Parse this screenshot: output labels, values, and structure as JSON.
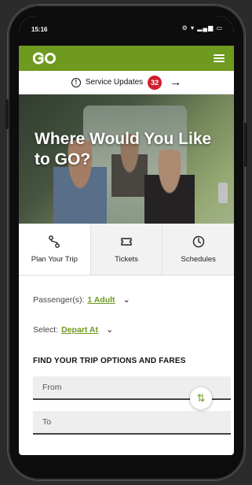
{
  "status_bar": {
    "time": "15:16",
    "icons": "⚙ ▾ ▂▄▆ ▭"
  },
  "header": {
    "menu_icon": "hamburger-menu-icon"
  },
  "service_updates": {
    "label": "Service Updates",
    "count": "32",
    "arrow": "→",
    "info_glyph": "!"
  },
  "hero": {
    "title": "Where Would You Like to GO?"
  },
  "tabs": [
    {
      "label": "Plan Your Trip",
      "icon": "route-icon",
      "active": true
    },
    {
      "label": "Tickets",
      "icon": "ticket-icon",
      "active": false
    },
    {
      "label": "Schedules",
      "icon": "clock-icon",
      "active": false
    }
  ],
  "trip_form": {
    "passengers_label": "Passenger(s):",
    "passengers_value": "1 Adult",
    "select_label": "Select:",
    "select_value": "Depart At",
    "section_title": "FIND YOUR TRIP OPTIONS AND FARES",
    "from_placeholder": "From",
    "to_placeholder": "To",
    "swap_glyph": "⇅",
    "chevron_glyph": "⌄"
  },
  "colors": {
    "brand_green": "#6e9a1f",
    "badge_red": "#d21f2e"
  }
}
